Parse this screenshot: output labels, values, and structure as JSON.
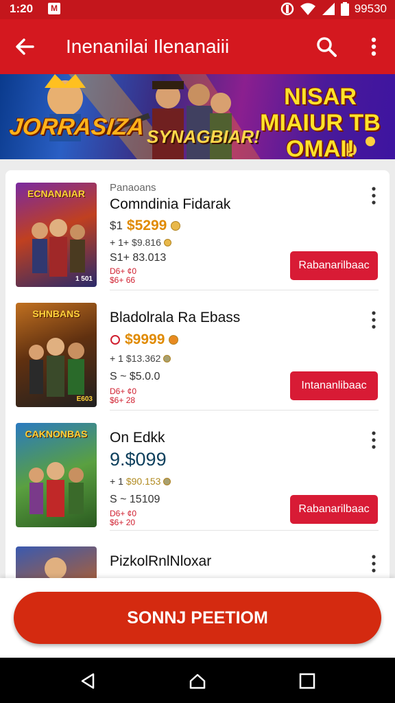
{
  "status_bar": {
    "time": "1:20",
    "notification_badge": "M",
    "battery_text": "99530"
  },
  "app_bar": {
    "title": "Inenanilai Ilenanaiii"
  },
  "banner": {
    "left_text": "JORRASIZA",
    "center_text": "SYNAGBIAR!",
    "right_text": "NISAR MIAIUR TB OMAI!"
  },
  "products": [
    {
      "category": "Panaoans",
      "name": "Comndinia Fidarak",
      "price_prefix": "$1",
      "price": "$5299",
      "sub1_prefix": "+ 1+",
      "sub1_value": "$9.816",
      "sub2": "S1+ 83.013",
      "sub3_line1": "D6+ ¢0",
      "sub3_line2": "$6+ 66",
      "button": "Rabanarilbaac",
      "thumb_title": "ECNANAIAR",
      "thumb_tag": "1 501"
    },
    {
      "category": "",
      "name": "Bladolrala Ra Ebass",
      "price_prefix": "",
      "price": "$9999",
      "sub1_prefix": "+ 1",
      "sub1_value": "$13.362",
      "sub2": "S ~ $5.0.0",
      "sub3_line1": "D6+ ¢0",
      "sub3_line2": "$6+ 28",
      "button": "Intananlibaac",
      "thumb_title": "SHNBANS",
      "thumb_tag": "E603"
    },
    {
      "category": "",
      "name": "On Edkk",
      "price_prefix": "",
      "price": "9.$099",
      "sub1_prefix": "+ 1",
      "sub1_value": "$90.153",
      "sub2": "S ~ 15109",
      "sub3_line1": "D6+ ¢0",
      "sub3_line2": "$6+ 20",
      "button": "Rabanarilbaac",
      "thumb_title": "CAKNONBAS",
      "thumb_tag": ""
    },
    {
      "category": "",
      "name": "PizkolRnlNloxar",
      "price_prefix": "",
      "price": "",
      "sub1_prefix": "",
      "sub1_value": "",
      "sub2": "",
      "sub3_line1": "",
      "sub3_line2": "",
      "button": "",
      "thumb_title": "",
      "thumb_tag": ""
    }
  ],
  "cta": {
    "label": "SONNJ PEETIOM"
  },
  "colors": {
    "primary": "#d4181f",
    "button": "#d81b35",
    "cta": "#d42a10",
    "price": "#e08a00"
  },
  "icons": [
    "back-arrow-icon",
    "search-icon",
    "more-vert-icon",
    "back-nav-icon",
    "home-nav-icon",
    "recents-nav-icon"
  ]
}
